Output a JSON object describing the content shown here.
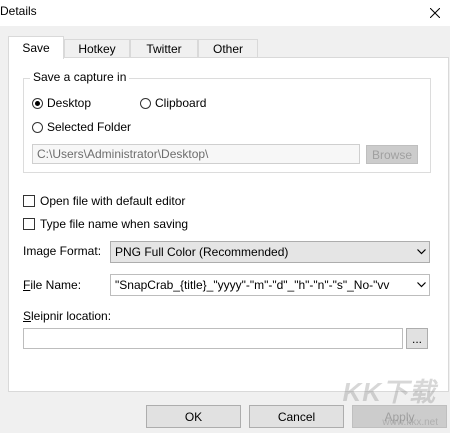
{
  "window": {
    "title": "Details"
  },
  "tabs": [
    {
      "label": "Save",
      "active": true
    },
    {
      "label": "Hotkey",
      "active": false
    },
    {
      "label": "Twitter",
      "active": false
    },
    {
      "label": "Other",
      "active": false
    }
  ],
  "save_group": {
    "legend": "Save a capture in",
    "options": [
      {
        "label": "Desktop",
        "checked": true
      },
      {
        "label": "Clipboard",
        "checked": false
      },
      {
        "label": "Selected Folder",
        "checked": false
      }
    ],
    "folder_path": "C:\\Users\\Administrator\\Desktop\\",
    "browse_label": "Browse"
  },
  "checkboxes": [
    {
      "label": "Open file with default editor",
      "checked": false
    },
    {
      "label": "Type file name when saving",
      "checked": false
    }
  ],
  "image_format": {
    "label": "Image Format:",
    "value": "PNG Full Color (Recommended)"
  },
  "file_name": {
    "label_first": "F",
    "label_rest": "ile Name:",
    "value": "\"SnapCrab_{title}_\"yyyy\"-\"m\"-\"d\"_\"h\"-\"n\"-\"s\"_No-\"vv"
  },
  "sleipnir": {
    "label_first": "S",
    "label_rest": "leipnir location:",
    "value": "",
    "browse_label": "..."
  },
  "buttons": {
    "ok": "OK",
    "cancel": "Cancel",
    "apply": "Apply"
  },
  "watermark": {
    "text": "KK下载",
    "url": "www.kkx.net"
  },
  "icons": {
    "close": "close-icon",
    "dropdown": "chevron-down-icon"
  }
}
